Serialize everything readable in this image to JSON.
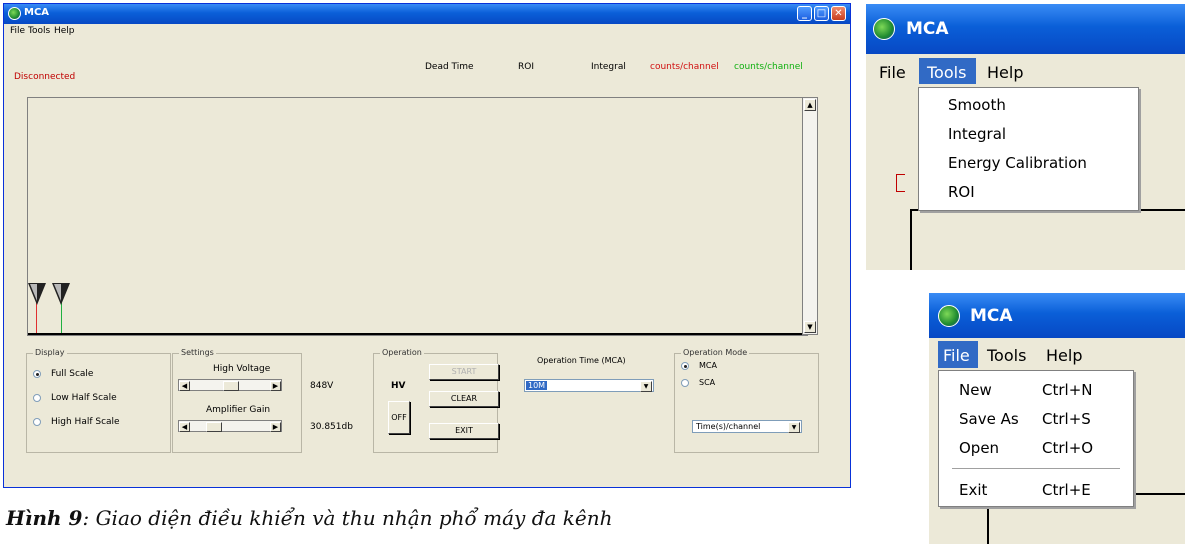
{
  "window": {
    "title": "MCA",
    "menu": [
      "File",
      "Tools",
      "Help"
    ]
  },
  "status": {
    "connection": "Disconnected",
    "connection_color": "#c00000"
  },
  "header": {
    "dead_time": "Dead Time",
    "roi": "ROI",
    "integral": "Integral",
    "counts_red": "counts/channel",
    "counts_green": "counts/channel",
    "red_color": "#d01010",
    "green_color": "#10b010"
  },
  "display": {
    "label": "Display",
    "options": [
      "Full Scale",
      "Low Half Scale",
      "High Half Scale"
    ],
    "selected": "Full Scale"
  },
  "settings": {
    "label": "Settings",
    "hv_label": "High Voltage",
    "hv_value": "848V",
    "gain_label": "Amplifier Gain",
    "gain_value": "30.851db",
    "hv_slider_fraction": 0.5,
    "gain_slider_fraction": 0.25
  },
  "operation": {
    "label": "Operation",
    "hv": "HV",
    "off": "OFF",
    "start": "START",
    "clear": "CLEAR",
    "exit": "EXIT"
  },
  "op_time": {
    "label": "Operation Time (MCA)",
    "value": "10M"
  },
  "op_mode": {
    "label": "Operation Mode",
    "options": [
      "MCA",
      "SCA"
    ],
    "selected": "MCA",
    "unit_value": "Time(s)/channel"
  },
  "zoom_tools": {
    "title": "MCA",
    "menu": [
      "File",
      "Tools",
      "Help"
    ],
    "items": [
      "Smooth",
      "Integral",
      "Energy Calibration",
      "ROI"
    ]
  },
  "zoom_file": {
    "title": "MCA",
    "menu": [
      "File",
      "Tools",
      "Help"
    ],
    "items": [
      {
        "label": "New",
        "shortcut": "Ctrl+N"
      },
      {
        "label": "Save As",
        "shortcut": "Ctrl+S"
      },
      {
        "label": "Open",
        "shortcut": "Ctrl+O"
      },
      {
        "label": "Exit",
        "shortcut": "Ctrl+E"
      }
    ]
  },
  "caption": {
    "label": "Hình 9",
    "text": ": Giao diện điều khiển và thu nhận phổ máy đa kênh"
  }
}
